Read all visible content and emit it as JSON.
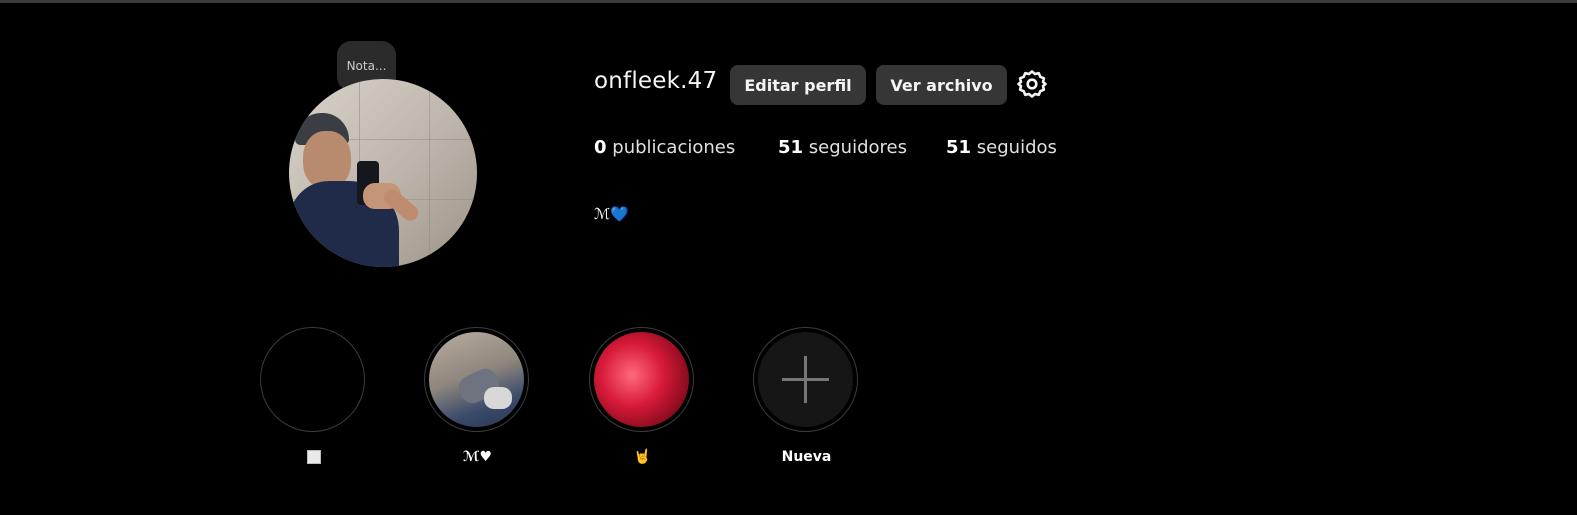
{
  "profile": {
    "note_label": "Nota...",
    "username": "onfleek.47",
    "edit_button": "Editar perfil",
    "archive_button": "Ver archivo",
    "settings_icon": "gear-icon",
    "stats": {
      "posts_count": "0",
      "posts_label": "publicaciones",
      "followers_count": "51",
      "followers_label": "seguidores",
      "following_count": "51",
      "following_label": "seguidos"
    },
    "bio_text": "ℳ",
    "bio_emoji": "💙"
  },
  "highlights": [
    {
      "label": "⬜"
    },
    {
      "label": "ℳ♥"
    },
    {
      "label": "🤘"
    },
    {
      "label": "Nueva"
    }
  ],
  "colors": {
    "background": "#000000",
    "button_bg": "#363636",
    "ring_border": "#3c3c3c",
    "bio_heart": "#3d8bff"
  }
}
